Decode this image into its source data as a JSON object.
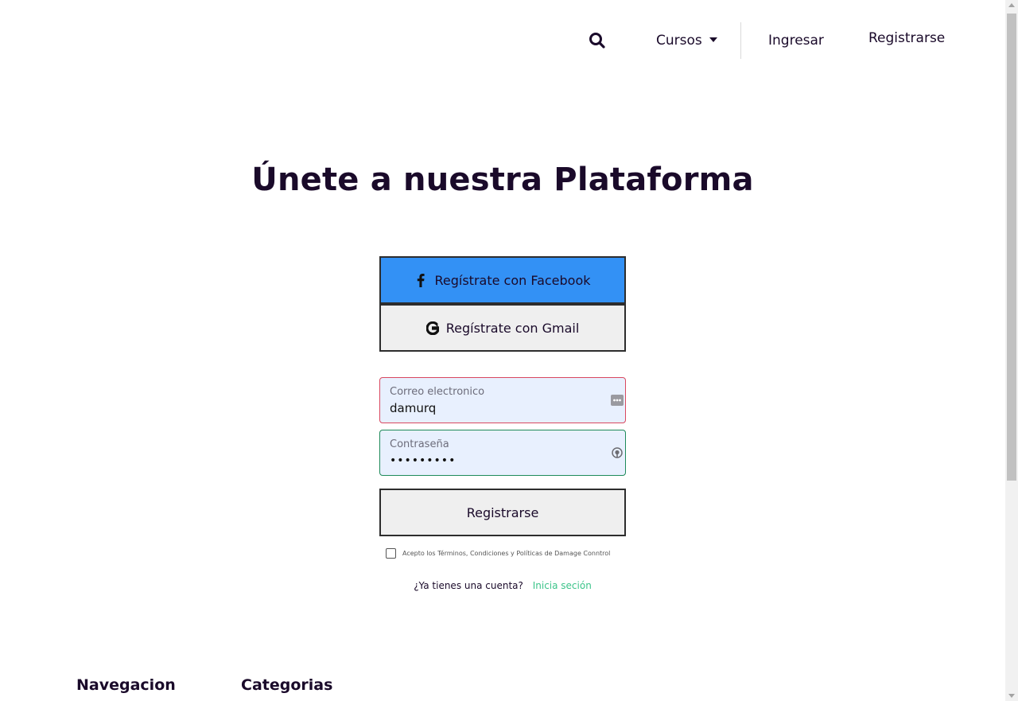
{
  "nav": {
    "search_icon": "search-icon",
    "cursos_label": "Cursos",
    "ingresar_label": "Ingresar",
    "registrarse_label": "Registrarse"
  },
  "main": {
    "title": "Únete a nuestra Plataforma",
    "facebook_button": "Regístrate con Facebook",
    "gmail_button": "Regístrate con Gmail",
    "email": {
      "label": "Correo electronico",
      "value": "damurq"
    },
    "password": {
      "label": "Contraseña",
      "value": "•••••••••"
    },
    "submit_button": "Registrarse",
    "terms_text": "Acepto los Términos, Condiciones y Políticas de Damage Conntrol",
    "have_account_text": "¿Ya tienes una cuenta?",
    "login_link": "Inicia seción"
  },
  "footer": {
    "navegacion_heading": "Navegacion",
    "categorias_heading": "Categorias"
  },
  "colors": {
    "facebook": "#3391f5",
    "link_green": "#3cc48a",
    "field_bg": "#e8f0fe",
    "email_border": "#d9485f",
    "password_border": "#1e8a5a",
    "text_dark": "#1a0a2a"
  }
}
